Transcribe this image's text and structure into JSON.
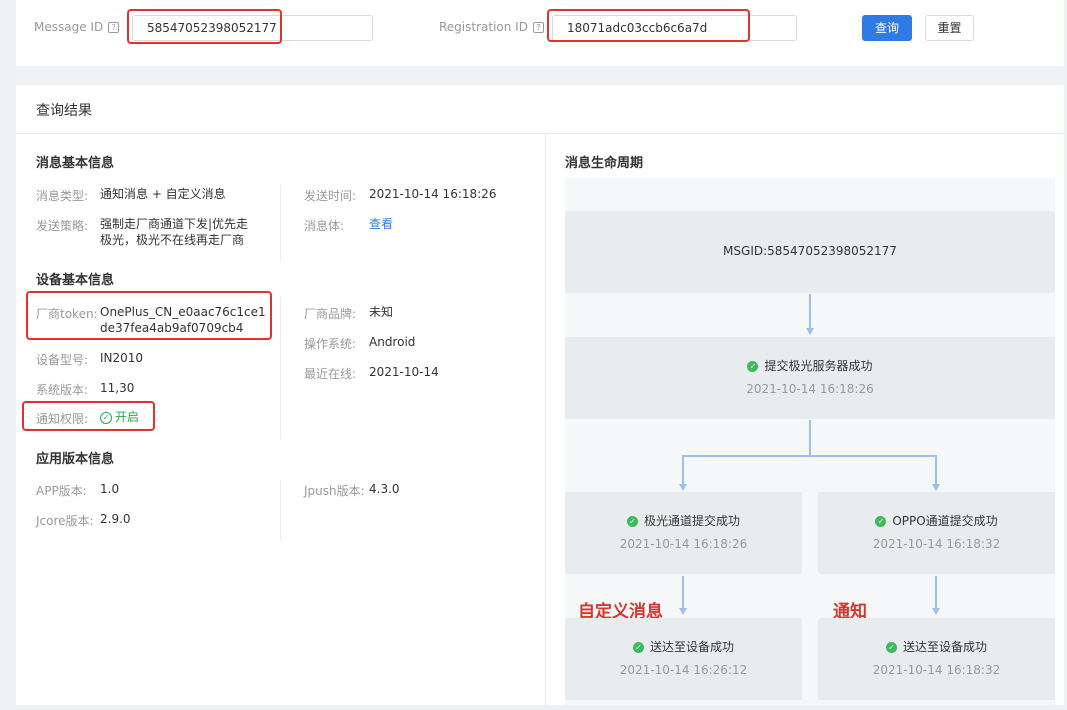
{
  "search": {
    "message_id_label": "Message ID",
    "message_id_value": "58547052398052177",
    "registration_id_label": "Registration ID",
    "registration_id_value": "18071adc03ccb6c6a7d",
    "help_glyph": "?",
    "query_button": "查询",
    "reset_button": "重置"
  },
  "results": {
    "title": "查询结果",
    "message_info": {
      "title": "消息基本信息",
      "type_label": "消息类型:",
      "type_value": "通知消息 + 自定义消息",
      "send_time_label": "发送时间:",
      "send_time_value": "2021-10-14 16:18:26",
      "strategy_label": "发送策略:",
      "strategy_value": "强制走厂商通道下发|优先走极光，极光不在线再走厂商",
      "body_label": "消息体:",
      "body_link": "查看"
    },
    "device_info": {
      "title": "设备基本信息",
      "token_label": "厂商token:",
      "token_value": "OnePlus_CN_e0aac76c1ce1de37fea4ab9af0709cb4",
      "brand_label": "厂商品牌:",
      "brand_value": "未知",
      "os_label": "操作系统:",
      "os_value": "Android",
      "model_label": "设备型号:",
      "model_value": "IN2010",
      "last_online_label": "最近在线:",
      "last_online_value": "2021-10-14",
      "sys_version_label": "系统版本:",
      "sys_version_value": "11,30",
      "notify_perm_label": "通知权限:",
      "notify_perm_value": "开启"
    },
    "app_info": {
      "title": "应用版本信息",
      "app_version_label": "APP版本:",
      "app_version_value": "1.0",
      "jpush_label": "Jpush版本:",
      "jpush_value": "4.3.0",
      "jcore_label": "Jcore版本:",
      "jcore_value": "2.9.0"
    },
    "lifecycle": {
      "title": "消息生命周期",
      "msgid": "MSGID:58547052398052177",
      "submit_title": "提交极光服务器成功",
      "submit_time": "2021-10-14 16:18:26",
      "jiguang_title": "极光通道提交成功",
      "jiguang_time": "2021-10-14 16:18:26",
      "oppo_title": "OPPO通道提交成功",
      "oppo_time": "2021-10-14 16:18:32",
      "deliver1_title": "送达至设备成功",
      "deliver1_time": "2021-10-14 16:26:12",
      "deliver2_title": "送达至设备成功",
      "deliver2_time": "2021-10-14 16:18:32",
      "note_custom": "自定义消息",
      "note_notify": "通知"
    }
  },
  "colors": {
    "primary": "#2f7ae5",
    "success": "#3dbb5a",
    "annotation_red": "#e0322f"
  }
}
